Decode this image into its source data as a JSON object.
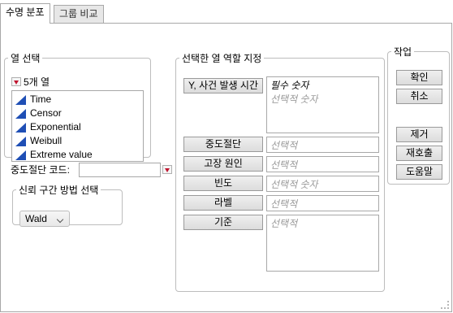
{
  "tabs": [
    {
      "label": "수명 분포",
      "active": true
    },
    {
      "label": "그룹 비교",
      "active": false
    }
  ],
  "select_columns": {
    "title": "열 선택",
    "count_label": "5개 열",
    "columns": [
      "Time",
      "Censor",
      "Exponential",
      "Weibull",
      "Extreme value"
    ]
  },
  "censor_code": {
    "label": "중도절단 코드:",
    "value": ""
  },
  "confidence": {
    "title": "신뢰 구간 방법 선택",
    "selected": "Wald"
  },
  "roles": {
    "title": "선택한 열 역할 지정",
    "items": [
      {
        "button": "Y, 사건 발생 시간",
        "required": "필수 숫자",
        "placeholder": "선택적 숫자"
      },
      {
        "button": "중도절단",
        "placeholder": "선택적"
      },
      {
        "button": "고장 원인",
        "placeholder": "선택적"
      },
      {
        "button": "빈도",
        "placeholder": "선택적 숫자"
      },
      {
        "button": "라벨",
        "placeholder": "선택적"
      },
      {
        "button": "기준",
        "placeholder": "선택적"
      }
    ]
  },
  "actions": {
    "title": "작업",
    "buttons": [
      "확인",
      "취소",
      "제거",
      "재호출",
      "도움말"
    ]
  },
  "colors": {
    "accent_triangle": "#c0152f",
    "continuous_icon": "#1f4fb5"
  }
}
